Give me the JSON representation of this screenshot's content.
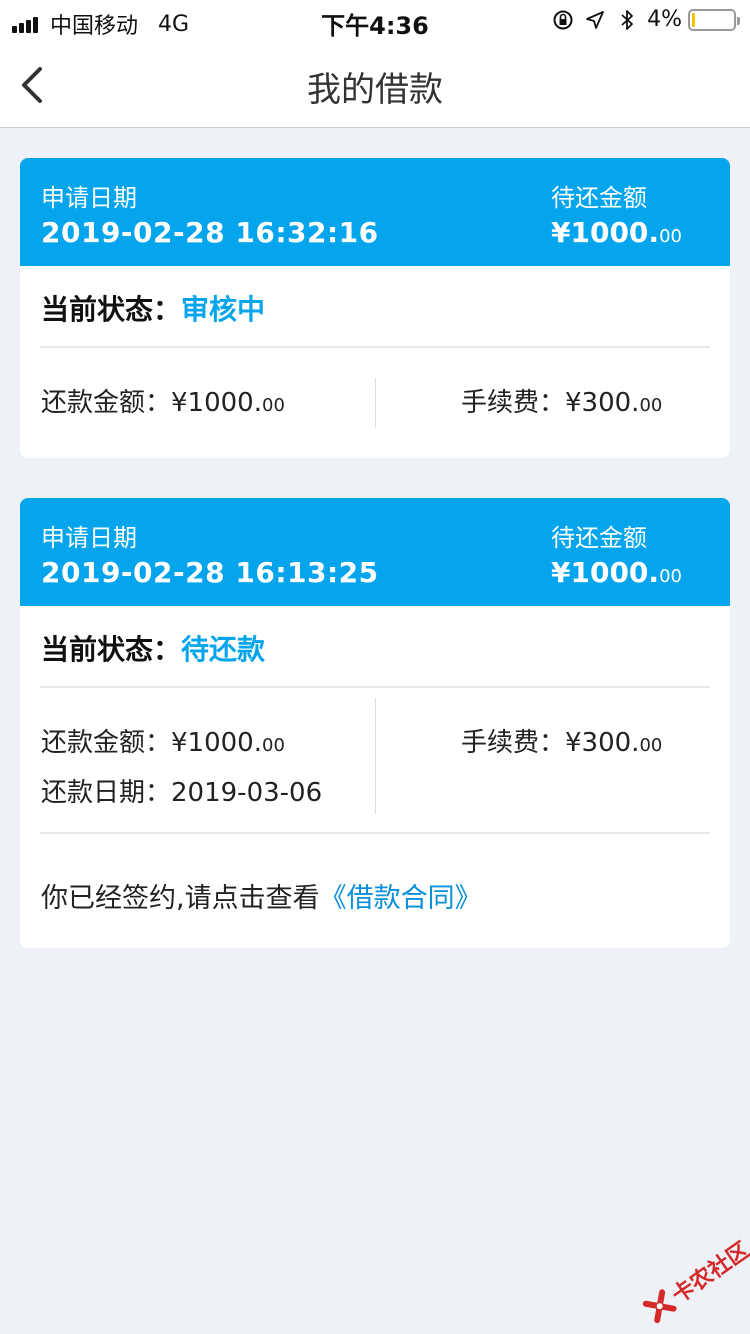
{
  "status_bar": {
    "carrier": "中国移动",
    "network": "4G",
    "time": "下午4:36",
    "battery": "4%",
    "battery_level": 0.04,
    "icons": [
      "orientation-lock-icon",
      "location-arrow-icon",
      "bluetooth-icon"
    ]
  },
  "nav": {
    "title": "我的借款",
    "back_icon": "chevron-left-icon"
  },
  "loans": [
    {
      "apply_label": "申请日期",
      "apply_date": "2019-02-28 16:32:16",
      "due_label": "待还金额",
      "due_amount_main": "¥1000.",
      "due_amount_cents": "00",
      "status_label": "当前状态：",
      "status_value": "审核中",
      "repay_amount_label": "还款金额：",
      "repay_amount_main": "¥1000.",
      "repay_amount_cents": "00",
      "fee_label": "手续费：",
      "fee_main": "¥300.",
      "fee_cents": "00"
    },
    {
      "apply_label": "申请日期",
      "apply_date": "2019-02-28 16:13:25",
      "due_label": "待还金额",
      "due_amount_main": "¥1000.",
      "due_amount_cents": "00",
      "status_label": "当前状态：",
      "status_value": "待还款",
      "repay_amount_label": "还款金额：",
      "repay_amount_main": "¥1000.",
      "repay_amount_cents": "00",
      "repay_date_label": "还款日期：",
      "repay_date": "2019-03-06",
      "fee_label": "手续费：",
      "fee_main": "¥300.",
      "fee_cents": "00",
      "contract_prefix": "你已经签约,请点击查看",
      "contract_link": "《借款合同》"
    }
  ],
  "watermark": {
    "text": "卡农社区"
  },
  "colors": {
    "accent": "#05a5ee",
    "link": "#0a8fd8",
    "background": "#eef2f7",
    "watermark": "#d42a2a"
  }
}
